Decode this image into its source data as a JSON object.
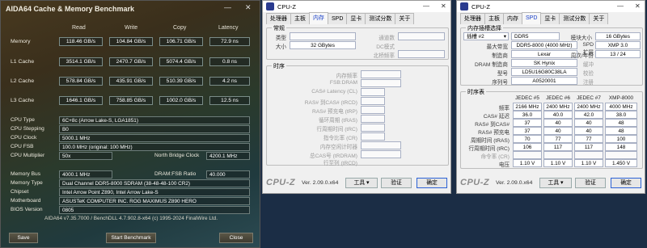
{
  "aida": {
    "title": "AIDA64 Cache & Memory Benchmark",
    "min_icon": "—",
    "close_icon": "✕",
    "cols": {
      "read": "Read",
      "write": "Write",
      "copy": "Copy",
      "latency": "Latency"
    },
    "rows": [
      {
        "label": "Memory",
        "read": "118.46 GB/s",
        "write": "104.84 GB/s",
        "copy": "106.71 GB/s",
        "latency": "72.9 ns"
      },
      {
        "label": "L1 Cache",
        "read": "3514.1 GB/s",
        "write": "2470.7 GB/s",
        "copy": "5074.4 GB/s",
        "latency": "0.8 ns"
      },
      {
        "label": "L2 Cache",
        "read": "578.84 GB/s",
        "write": "435.91 GB/s",
        "copy": "510.39 GB/s",
        "latency": "4.2 ns"
      },
      {
        "label": "L3 Cache",
        "read": "1646.1 GB/s",
        "write": "758.85 GB/s",
        "copy": "1002.0 GB/s",
        "latency": "12.5 ns"
      }
    ],
    "info": {
      "cpu_type_l": "CPU Type",
      "cpu_type": "6C+8c  (Arrow Lake-S, LGA1851)",
      "cpu_stepping_l": "CPU Stepping",
      "cpu_stepping": "B0",
      "cpu_clock_l": "CPU Clock",
      "cpu_clock": "5000.1 MHz",
      "cpu_fsb_l": "CPU FSB",
      "cpu_fsb": "100.0 MHz  (original: 100 MHz)",
      "cpu_mult_l": "CPU Multiplier",
      "cpu_mult": "50x",
      "nb_clock_l": "North Bridge Clock",
      "nb_clock": "4200.1 MHz",
      "mem_bus_l": "Memory Bus",
      "mem_bus": "4000.1 MHz",
      "dram_ratio_l": "DRAM:FSB Ratio",
      "dram_ratio": "40.000",
      "mem_type_l": "Memory Type",
      "mem_type": "Dual Channel DDR5-8000 SDRAM  (38-48-48-100 CR2)",
      "chipset_l": "Chipset",
      "chipset": "Intel Arrow Point Z890, Intel Arrow Lake-S",
      "mobo_l": "Motherboard",
      "mobo": "ASUSTeK COMPUTER INC. ROG MAXIMUS Z890 HERO",
      "bios_l": "BIOS Version",
      "bios": "0805"
    },
    "footer": "AIDA64 v7.35.7000 / BenchDLL 4.7.902.8-x64  (c) 1995-2024 FinalWire Ltd.",
    "save": "Save",
    "start": "Start Benchmark",
    "close": "Close"
  },
  "cpuz_mid": {
    "title": "CPU-Z",
    "tabs": [
      "处理器",
      "主板",
      "内存",
      "SPD",
      "显卡",
      "测试分数",
      "关于"
    ],
    "general_title": "常规",
    "type_l": "类型",
    "size_l": "大小",
    "size": "32 GBytes",
    "channels_l": "通道数",
    "dc_l": "DC模式",
    "nb_freq_l": "北桥频率",
    "timing_title": "时序",
    "timings": [
      "内存频率",
      "FSB:DRAM",
      "CAS# Latency (CL)",
      "RAS# 到CAS# (tRCD)",
      "RAS# 预充电 (tRP)",
      "循环周期 (tRAS)",
      "行周期时间 (tRC)",
      "指令比率 (CR)",
      "内存空闲计时器",
      "总CAS号 (tRDRAM)",
      "行至列 (tRCD)"
    ],
    "brand": "CPU-Z",
    "ver": "Ver. 2.09.0.x64",
    "tools": "工具",
    "validate": "验证",
    "ok": "确定"
  },
  "cpuz_right": {
    "title": "CPU-Z",
    "tabs": [
      "处理器",
      "主板",
      "内存",
      "SPD",
      "显卡",
      "测试分数",
      "关于"
    ],
    "slot_title": "内存插槽选择",
    "slot": "插槽 #2",
    "ddr": "DDR5",
    "module_size_l": "模块大小",
    "module_size": "16 GBytes",
    "max_bw_l": "最大带宽",
    "max_bw": "DDR5-8000 (4000 MHz)",
    "spd_ext_l": "SPD扩展",
    "spd_ext": "XMP 3.0",
    "mfr_l": "制造商",
    "mfr": "Lexar",
    "week_l": "周次/年份",
    "week": "13 / 24",
    "dram_mfr_l": "DRAM 制造商",
    "dram_mfr": "SK Hynix",
    "buffered_l": "缓冲",
    "part_l": "型号",
    "part": "LD5U16G80C38LA",
    "corr_l": "校验",
    "serial_l": "序列号",
    "serial": "A0520001",
    "reg_l": "注册",
    "timing_title": "时序表",
    "headers": [
      "JEDEC #5",
      "JEDEC #6",
      "JEDEC #7",
      "XMP-8000"
    ],
    "rows": [
      {
        "label": "频率",
        "vals": [
          "2166 MHz",
          "2400 MHz",
          "2400 MHz",
          "4000 MHz"
        ]
      },
      {
        "label": "CAS# 延迟",
        "vals": [
          "36.0",
          "40.0",
          "42.0",
          "38.0"
        ]
      },
      {
        "label": "RAS# 到CAS#",
        "vals": [
          "37",
          "40",
          "40",
          "48"
        ]
      },
      {
        "label": "RAS# 预充电",
        "vals": [
          "37",
          "40",
          "40",
          "48"
        ]
      },
      {
        "label": "周期时间 (tRAS)",
        "vals": [
          "70",
          "77",
          "77",
          "100"
        ]
      },
      {
        "label": "行周期时间 (tRC)",
        "vals": [
          "106",
          "117",
          "117",
          "148"
        ]
      },
      {
        "label": "命令率 (CR)",
        "vals": [
          "",
          "",
          "",
          ""
        ]
      },
      {
        "label": "电压",
        "vals": [
          "1.10 V",
          "1.10 V",
          "1.10 V",
          "1.450 V"
        ]
      }
    ],
    "brand": "CPU-Z",
    "ver": "Ver. 2.09.0.x64",
    "tools": "工具",
    "validate": "验证",
    "ok": "确定"
  }
}
